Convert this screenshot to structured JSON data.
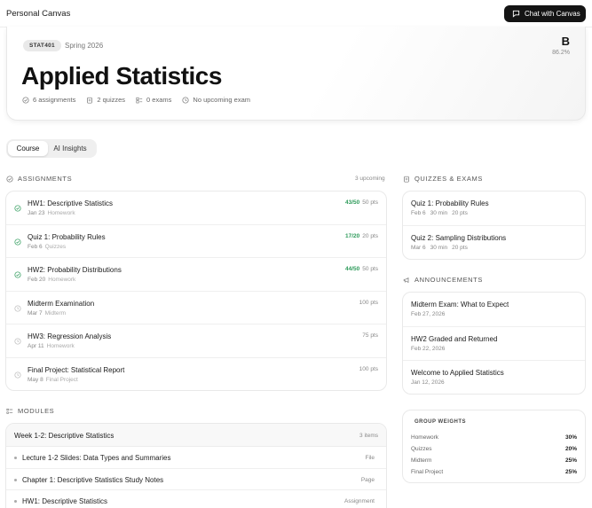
{
  "app": {
    "brand": "Personal Canvas",
    "chat_button": "Chat with Canvas"
  },
  "course": {
    "code": "STAT401",
    "term": "Spring 2026",
    "title": "Applied Statistics",
    "grade_letter": "B",
    "grade_percent": "86.2%",
    "stats": {
      "assignments": "6 assignments",
      "quizzes": "2 quizzes",
      "exams": "0 exams",
      "upcoming_exam": "No upcoming exam"
    }
  },
  "tabs": [
    {
      "label": "Course",
      "active": true
    },
    {
      "label": "AI Insights",
      "active": false
    }
  ],
  "assignments": {
    "heading": "ASSIGNMENTS",
    "upcoming": "3 upcoming",
    "items": [
      {
        "title": "HW1: Descriptive Statistics",
        "date": "Jan 23",
        "category": "Homework",
        "score": "43/50",
        "points": "50 pts",
        "status": "completed"
      },
      {
        "title": "Quiz 1: Probability Rules",
        "date": "Feb 6",
        "category": "Quizzes",
        "score": "17/20",
        "points": "20 pts",
        "status": "completed"
      },
      {
        "title": "HW2: Probability Distributions",
        "date": "Feb 20",
        "category": "Homework",
        "score": "44/50",
        "points": "50 pts",
        "status": "completed"
      },
      {
        "title": "Midterm Examination",
        "date": "Mar 7",
        "category": "Midterm",
        "score": "",
        "points": "100 pts",
        "status": "upcoming"
      },
      {
        "title": "HW3: Regression Analysis",
        "date": "Apr 11",
        "category": "Homework",
        "score": "",
        "points": "75 pts",
        "status": "upcoming"
      },
      {
        "title": "Final Project: Statistical Report",
        "date": "May 8",
        "category": "Final Project",
        "score": "",
        "points": "100 pts",
        "status": "upcoming"
      }
    ]
  },
  "quizzes": {
    "heading": "QUIZZES & EXAMS",
    "items": [
      {
        "title": "Quiz 1: Probability Rules",
        "date": "Feb 6",
        "duration": "30 min",
        "points": "20 pts"
      },
      {
        "title": "Quiz 2: Sampling Distributions",
        "date": "Mar 6",
        "duration": "30 min",
        "points": "20 pts"
      }
    ]
  },
  "announcements": {
    "heading": "ANNOUNCEMENTS",
    "items": [
      {
        "title": "Midterm Exam: What to Expect",
        "date": "Feb 27, 2026"
      },
      {
        "title": "HW2 Graded and Returned",
        "date": "Feb 22, 2026"
      },
      {
        "title": "Welcome to Applied Statistics",
        "date": "Jan 12, 2026"
      }
    ]
  },
  "modules": {
    "heading": "MODULES",
    "week_title": "Week 1-2: Descriptive Statistics",
    "week_count": "3 items",
    "items": [
      {
        "label": "Lecture 1-2 Slides: Data Types and Summaries",
        "type": "File"
      },
      {
        "label": "Chapter 1: Descriptive Statistics Study Notes",
        "type": "Page"
      },
      {
        "label": "HW1: Descriptive Statistics",
        "type": "Assignment"
      }
    ]
  },
  "group_weights": {
    "heading": "GROUP WEIGHTS",
    "items": [
      {
        "name": "Homework",
        "value": "30%"
      },
      {
        "name": "Quizzes",
        "value": "20%"
      },
      {
        "name": "Midterm",
        "value": "25%"
      },
      {
        "name": "Final Project",
        "value": "25%"
      }
    ]
  },
  "colors": {
    "accent_green": "#2e9b5b",
    "dark": "#141414",
    "muted": "#888888"
  }
}
